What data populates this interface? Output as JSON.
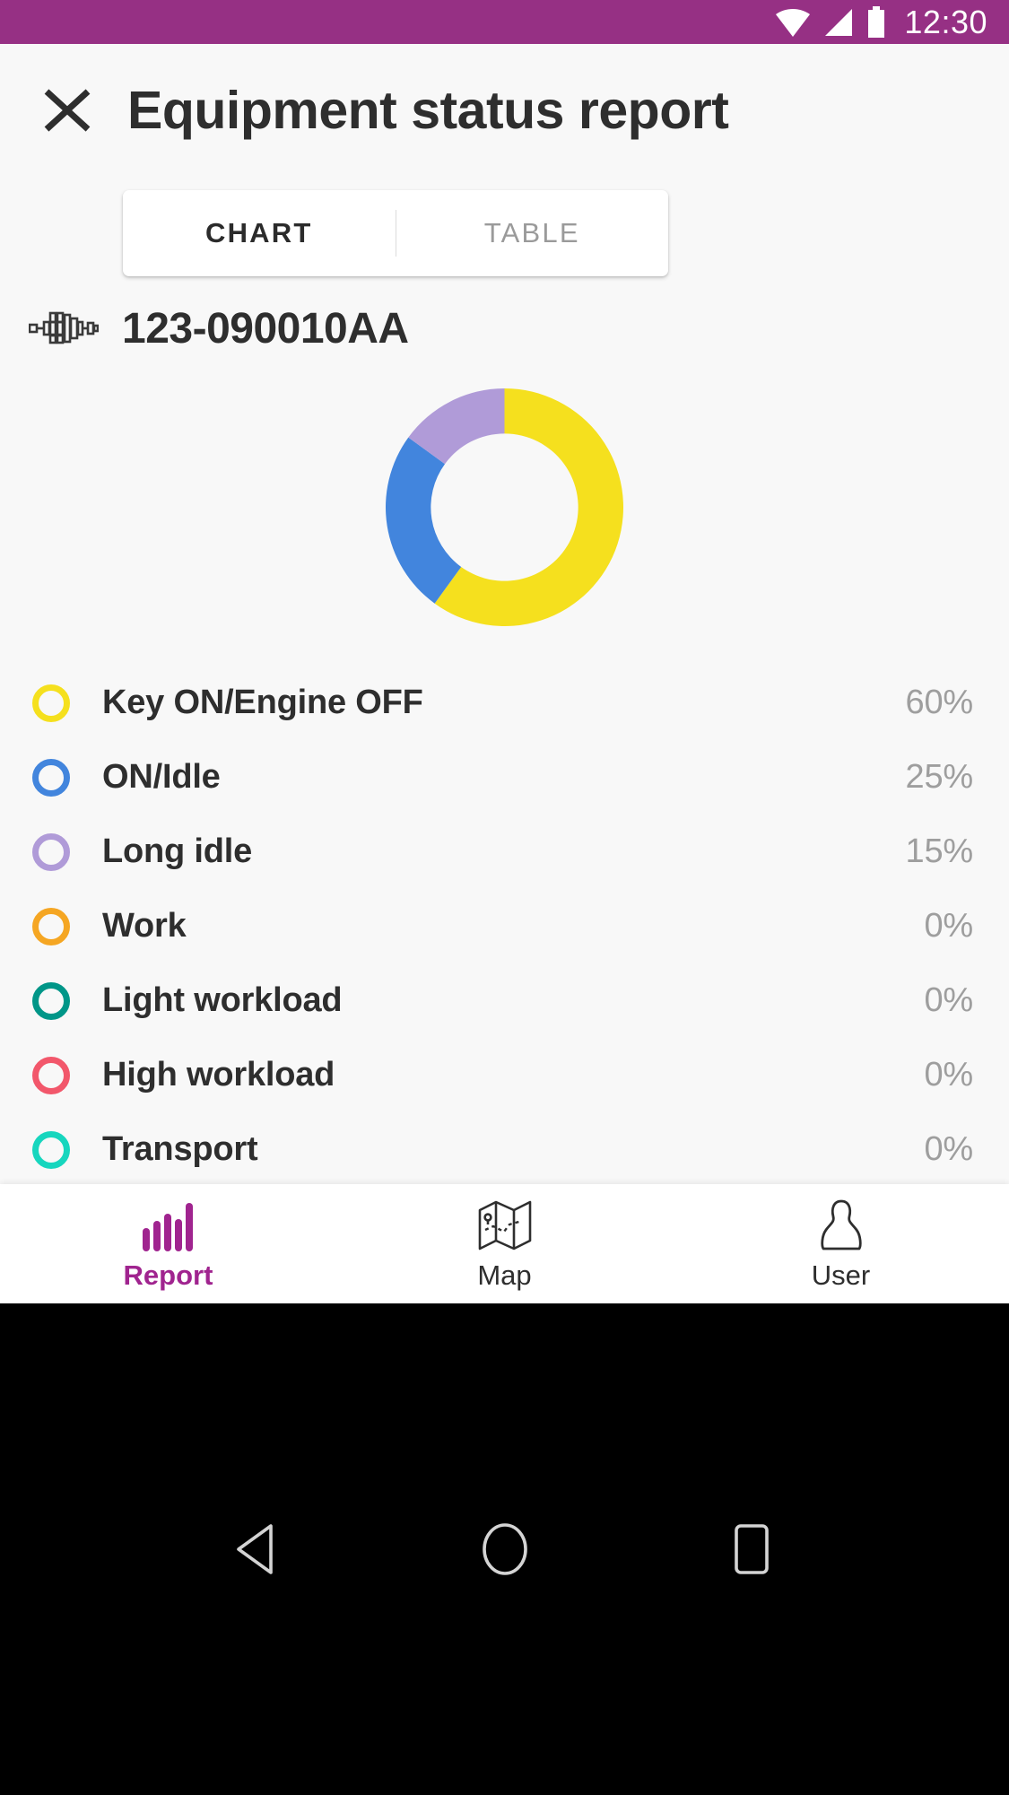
{
  "statusbar": {
    "time": "12:30",
    "background": "#963084",
    "icons": [
      "wifi-icon",
      "cellular-signal-icon",
      "battery-icon"
    ]
  },
  "header": {
    "close_icon": "close-icon",
    "title": "Equipment status report"
  },
  "segmented": {
    "tabs": [
      {
        "label": "CHART",
        "active": true
      },
      {
        "label": "TABLE",
        "active": false
      }
    ]
  },
  "equipment": {
    "icon": "machinery-crankshaft-icon",
    "id": "123-090010AA"
  },
  "chart_data": {
    "type": "pie",
    "title": "123-090010AA",
    "subtype": "donut",
    "start_angle": 0,
    "direction": "clockwise",
    "inner_radius_ratio": 0.62,
    "categories": [
      "Key ON/Engine OFF",
      "ON/Idle",
      "Long idle",
      "Work",
      "Light workload",
      "High workload",
      "Transport"
    ],
    "values": [
      60,
      25,
      15,
      0,
      0,
      0,
      0
    ],
    "value_labels": [
      "60%",
      "25%",
      "15%",
      "0%",
      "0%",
      "0%",
      "0%"
    ],
    "colors": [
      "#F5E01E",
      "#4285DD",
      "#B09BD8",
      "#F5A623",
      "#009688",
      "#F2576B",
      "#17D6BE"
    ],
    "unit": "%",
    "legend_position": "bottom",
    "grid": false
  },
  "legend": {
    "rows": [
      {
        "label": "Key ON/Engine OFF",
        "pct": "60%",
        "color": "#F5E01E"
      },
      {
        "label": "ON/Idle",
        "pct": "25%",
        "color": "#4285DD"
      },
      {
        "label": "Long idle",
        "pct": "15%",
        "color": "#B09BD8"
      },
      {
        "label": "Work",
        "pct": "0%",
        "color": "#F5A623"
      },
      {
        "label": "Light workload",
        "pct": "0%",
        "color": "#009688"
      },
      {
        "label": "High workload",
        "pct": "0%",
        "color": "#F2576B"
      },
      {
        "label": "Transport",
        "pct": "0%",
        "color": "#17D6BE"
      }
    ]
  },
  "tabbar": {
    "accent": "#a0248f",
    "items": [
      {
        "label": "Report",
        "icon": "bar-chart-icon",
        "active": true
      },
      {
        "label": "Map",
        "icon": "folded-map-icon",
        "active": false
      },
      {
        "label": "User",
        "icon": "person-icon",
        "active": false
      }
    ]
  },
  "sysnav": {
    "buttons": [
      "back-triangle-icon",
      "home-circle-icon",
      "recents-square-icon"
    ]
  }
}
